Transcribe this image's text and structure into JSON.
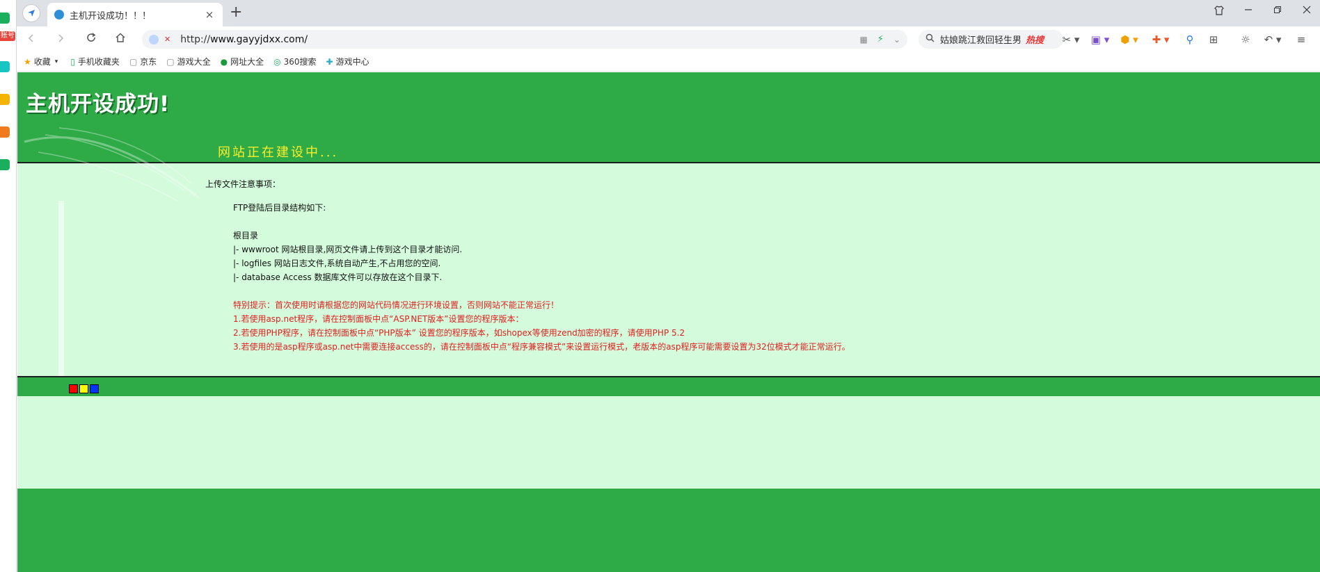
{
  "browser": {
    "tab": {
      "title": "主机开设成功！！！",
      "close_icon": "×"
    },
    "new_tab_icon": "+",
    "address": {
      "url_scheme": "http://",
      "url_host": "www.gayyjdxx.com/"
    },
    "search": {
      "query": "姑娘跳江救回轻生男",
      "badge": "热搜"
    },
    "side_badge": "账号",
    "bookmarks": [
      {
        "label": "收藏",
        "icon": "star-icon"
      },
      {
        "label": "手机收藏夹",
        "icon": "phone-icon"
      },
      {
        "label": "京东",
        "icon": "page-icon"
      },
      {
        "label": "游戏大全",
        "icon": "page-icon"
      },
      {
        "label": "网址大全",
        "icon": "globe-icon"
      },
      {
        "label": "360搜索",
        "icon": "search-360-icon"
      },
      {
        "label": "游戏中心",
        "icon": "gamepad-icon"
      }
    ]
  },
  "page": {
    "header_title": "主机开设成功!",
    "header_subtitle": "网站正在建设中...",
    "notice_title": "上传文件注意事项：",
    "ftp_intro": "FTP登陆后目录结构如下:",
    "root_label": "根目录",
    "dir_lines": [
      "|- wwwroot 网站根目录,网页文件请上传到这个目录才能访问.",
      "|- logfiles 网站日志文件,系统自动产生,不占用您的空间.",
      "|- database Access 数据库文件可以存放在这个目录下."
    ],
    "tips": [
      "特别提示：首次使用时请根据您的网站代码情况进行环境设置，否则网站不能正常运行！",
      "1.若使用asp.net程序，请在控制面板中点“ASP.NET版本”设置您的程序版本：",
      "2.若使用PHP程序，请在控制面板中点“PHP版本” 设置您的程序版本，如shopex等使用zend加密的程序，请使用PHP 5.2",
      "3.若使用的是asp程序或asp.net中需要连接access的，请在控制面板中点“程序兼容模式”来设置运行模式，老版本的asp程序可能需要设置为32位模式才能正常运行。"
    ]
  },
  "colors": {
    "green": "#2eaa47",
    "light_green": "#d3fbdc",
    "subtitle_yellow": "#ffef2a",
    "tip_red": "#e21e1e",
    "sq_red": "#ff0000",
    "sq_yellow": "#ffff00",
    "sq_blue": "#0033ff"
  }
}
